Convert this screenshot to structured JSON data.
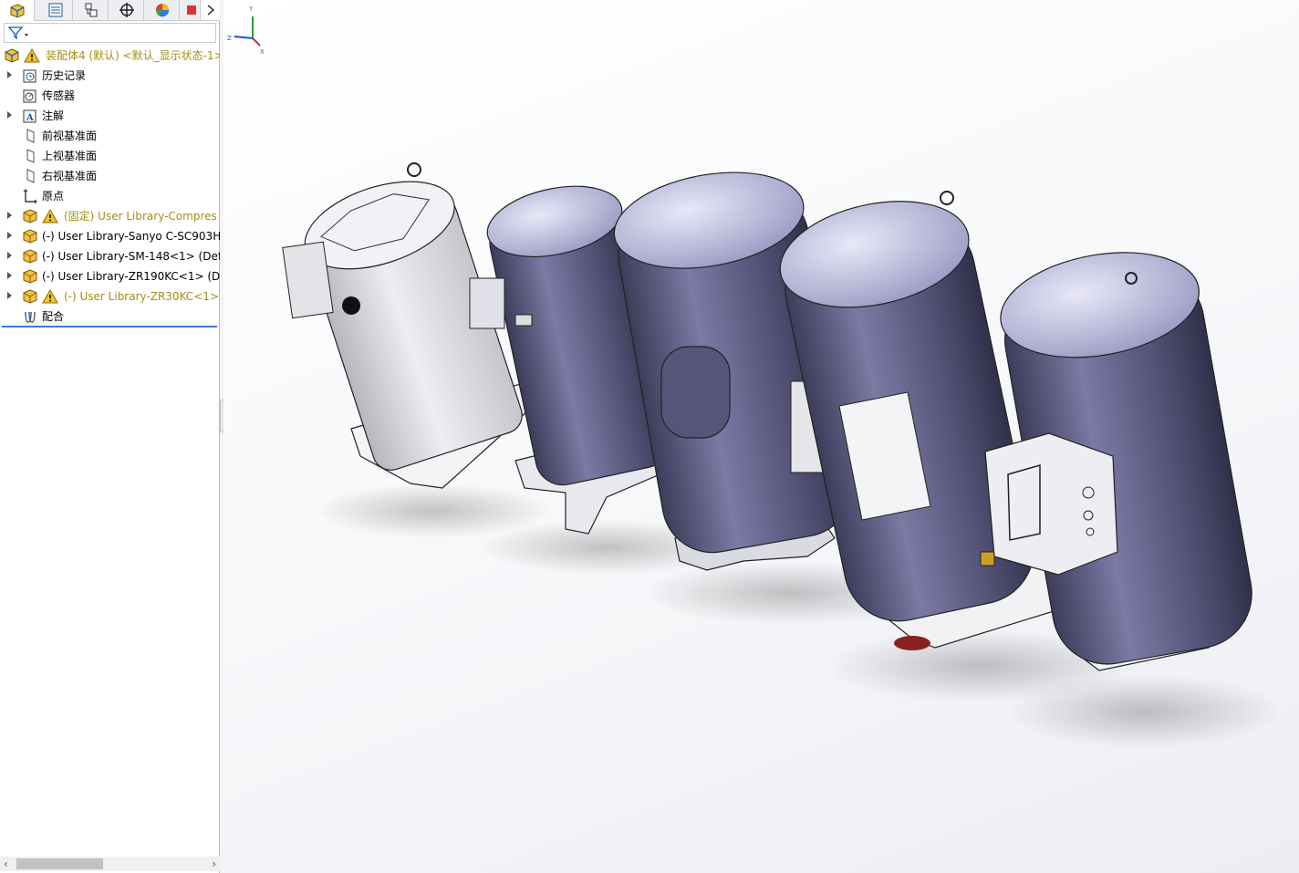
{
  "panel": {
    "tabs": [
      {
        "name": "feature-manager-tab",
        "icon": "assembly-icon"
      },
      {
        "name": "property-manager-tab",
        "icon": "property-icon"
      },
      {
        "name": "configuration-manager-tab",
        "icon": "configuration-icon"
      },
      {
        "name": "dimxpert-manager-tab",
        "icon": "crosshair-icon"
      },
      {
        "name": "display-manager-tab",
        "icon": "appearance-icon"
      },
      {
        "name": "cam-tab",
        "icon": "cam-icon"
      }
    ],
    "filter_icon": "filter-icon",
    "tree": [
      {
        "label": "装配体4 (默认) <默认_显示状态-1>",
        "icon": "assembly-icon",
        "warning": true,
        "expand": false
      },
      {
        "label": "历史记录",
        "icon": "history-icon",
        "warning": false,
        "expand": true
      },
      {
        "label": "传感器",
        "icon": "sensor-icon",
        "warning": false,
        "expand": false
      },
      {
        "label": "注解",
        "icon": "annotation-icon",
        "warning": false,
        "expand": true
      },
      {
        "label": "前视基准面",
        "icon": "plane-icon",
        "warning": false,
        "expand": false
      },
      {
        "label": "上视基准面",
        "icon": "plane-icon",
        "warning": false,
        "expand": false
      },
      {
        "label": "右视基准面",
        "icon": "plane-icon",
        "warning": false,
        "expand": false
      },
      {
        "label": "原点",
        "icon": "origin-icon",
        "warning": false,
        "expand": false
      },
      {
        "label": "(固定) User Library-Compres",
        "icon": "subassembly-icon",
        "warning": true,
        "expand": true
      },
      {
        "label": "(-) User Library-Sanyo C-SC903H",
        "icon": "subassembly-icon",
        "warning": false,
        "expand": true
      },
      {
        "label": "(-) User Library-SM-148<1> (Def",
        "icon": "subassembly-icon",
        "warning": false,
        "expand": true
      },
      {
        "label": "(-) User Library-ZR190KC<1> (De",
        "icon": "subassembly-icon",
        "warning": false,
        "expand": true
      },
      {
        "label": "(-) User Library-ZR30KC<1>",
        "icon": "subassembly-icon",
        "warning": true,
        "expand": true
      },
      {
        "label": "配合",
        "icon": "mates-icon",
        "warning": false,
        "expand": false
      }
    ]
  },
  "viewport": {
    "triad": {
      "x": "X",
      "y": "Y",
      "z": "Z"
    },
    "colors": {
      "body_dark": "#55557a",
      "body_light": "#e4e2ea",
      "dome": "#c8c8e6",
      "base": "#f2f2f4"
    }
  }
}
